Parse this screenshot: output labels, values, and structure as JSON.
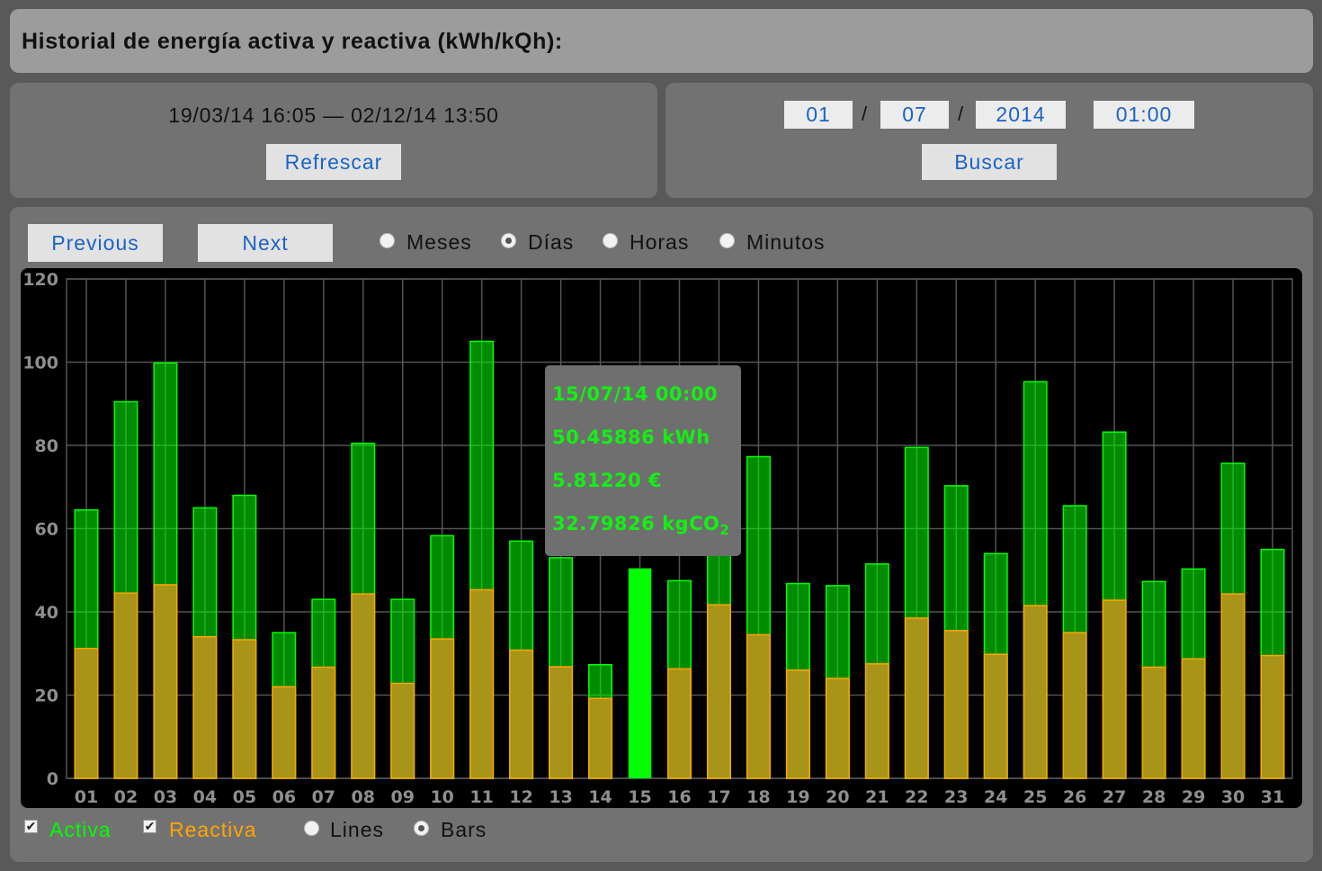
{
  "title": "Historial de energía activa y reactiva (kWh/kQh):",
  "range": {
    "text": "19/03/14 16:05 — 02/12/14 13:50",
    "refresh_label": "Refrescar"
  },
  "search": {
    "day": "01",
    "month": "07",
    "year": "2014",
    "time": "01:00",
    "separator": "/",
    "search_label": "Buscar"
  },
  "nav": {
    "previous_label": "Previous",
    "next_label": "Next"
  },
  "granularity": {
    "options": [
      "Meses",
      "Días",
      "Horas",
      "Minutos"
    ],
    "selected": "Días"
  },
  "legend": {
    "activa_label": "Activa",
    "reactiva_label": "Reactiva",
    "activa_checked": true,
    "reactiva_checked": true,
    "lines_label": "Lines",
    "bars_label": "Bars",
    "mode_selected": "Bars"
  },
  "tooltip": {
    "date": "15/07/14 00:00",
    "energy": "50.45886 kWh",
    "cost": "5.81220 €",
    "co2_value": "32.79826 kgCO",
    "co2_sub": "2"
  },
  "colors": {
    "activa": "#00ff00",
    "reactiva": "#ffa500",
    "background": "#000000",
    "grid": "#545454"
  },
  "chart_data": {
    "type": "bar",
    "categories": [
      "01",
      "02",
      "03",
      "04",
      "05",
      "06",
      "07",
      "08",
      "09",
      "10",
      "11",
      "12",
      "13",
      "14",
      "15",
      "16",
      "17",
      "18",
      "19",
      "20",
      "21",
      "22",
      "23",
      "24",
      "25",
      "26",
      "27",
      "28",
      "29",
      "30",
      "31"
    ],
    "series": [
      {
        "name": "Activa",
        "values": [
          64.5,
          90.5,
          99.8,
          65,
          68,
          35,
          43,
          80.5,
          43,
          58.3,
          105,
          57,
          53,
          27.3,
          50.45886,
          47.5,
          60,
          77.3,
          46.8,
          46.3,
          51.5,
          79.5,
          70.3,
          54,
          95.3,
          65.5,
          83.2,
          47.3,
          50.3,
          75.7,
          55
        ]
      },
      {
        "name": "Reactiva",
        "values": [
          31.2,
          44.5,
          46.5,
          34,
          33.3,
          22,
          26.7,
          44.3,
          22.8,
          33.5,
          45.3,
          30.8,
          26.8,
          19.2,
          null,
          26.3,
          41.7,
          34.5,
          26,
          24,
          27.5,
          38.5,
          35.5,
          29.8,
          41.5,
          35,
          42.8,
          26.7,
          28.7,
          44.3,
          29.5
        ]
      }
    ],
    "highlight_index": 14,
    "ylim": [
      0,
      120
    ],
    "yticks": [
      0,
      20,
      40,
      60,
      80,
      100,
      120
    ],
    "grid": true
  }
}
